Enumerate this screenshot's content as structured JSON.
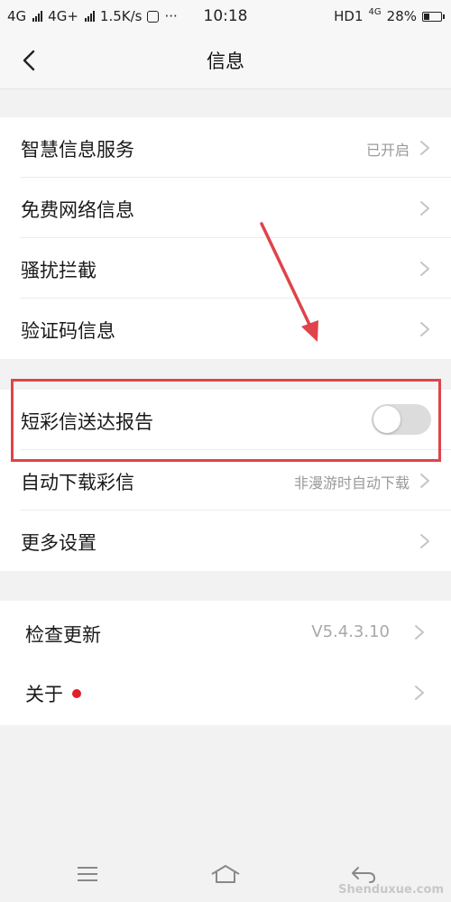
{
  "status_bar": {
    "net1": "4G",
    "net2": "4G+",
    "speed": "1.5K/s",
    "more": "···",
    "time": "10:18",
    "hd": "HD1",
    "net3": "4G",
    "battery_pct": "28%",
    "battery_level": 0.28
  },
  "header": {
    "title": "信息"
  },
  "section1": {
    "items": [
      {
        "label": "智慧信息服务",
        "value": "已开启"
      },
      {
        "label": "免费网络信息",
        "value": ""
      },
      {
        "label": "骚扰拦截",
        "value": ""
      },
      {
        "label": "验证码信息",
        "value": ""
      }
    ]
  },
  "section2": {
    "items": [
      {
        "label": "短彩信送达报告",
        "toggle": false
      },
      {
        "label": "自动下载彩信",
        "value": "非漫游时自动下载"
      },
      {
        "label": "更多设置",
        "value": ""
      }
    ]
  },
  "section3": {
    "items": [
      {
        "label": "检查更新",
        "value": "V5.4.3.10"
      },
      {
        "label": "关于",
        "badge": "red-dot"
      }
    ]
  },
  "colors": {
    "annotation": "#e0434a",
    "badge": "#e0202a",
    "toggle_off": "#dcdcdc"
  },
  "watermark": "Shenduxue.com"
}
